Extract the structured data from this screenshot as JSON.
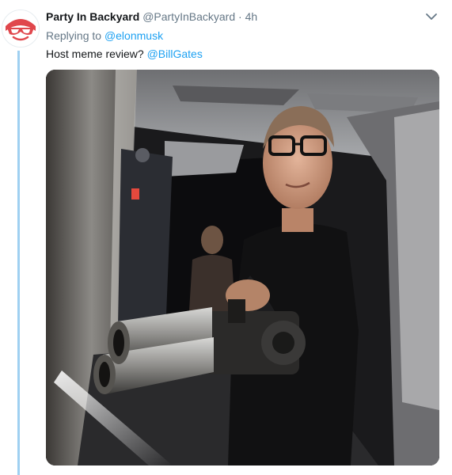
{
  "tweet": {
    "display_name": "Party In Backyard",
    "handle": "@PartyInBackyard",
    "separator": "·",
    "time": "4h",
    "replying_prefix": "Replying to",
    "replying_to": "@elonmusk",
    "text": "Host meme review?",
    "mention": "@BillGates"
  },
  "icons": {
    "avatar": "party-logo-icon",
    "menu": "chevron-down-icon"
  },
  "colors": {
    "link": "#1da1f2",
    "secondary_text": "#657786",
    "primary_text": "#14171a",
    "thread_line": "#9fd0f1",
    "avatar_red": "#e0474c"
  }
}
